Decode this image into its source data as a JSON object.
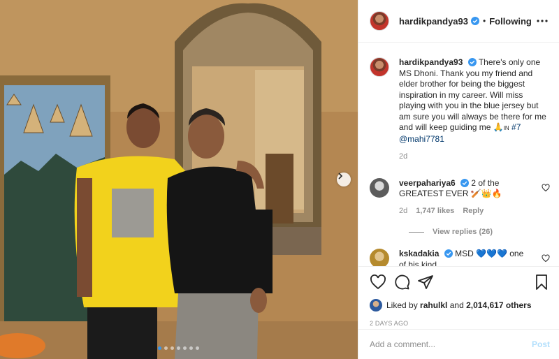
{
  "post": {
    "username": "hardikpandya93",
    "follow_status": "Following",
    "separator": "•",
    "caption": {
      "text": "There's only one MS Dhoni. Thank you my friend and elder brother for being the biggest inspiration in my career. Will miss playing with you in the blue jersey but am sure you will always be there for me and will keep guiding me 🙏",
      "in_label": "IN",
      "hashtag": "#7",
      "mention": "@mahi7781",
      "time": "2d"
    },
    "comments": [
      {
        "username": "veerpahariya6",
        "text": "2 of the GREATEST EVER 🏏👑🔥",
        "time": "2d",
        "likes": "1,747 likes",
        "reply_label": "Reply",
        "view_replies": "View replies (26)"
      },
      {
        "username": "kskadakia",
        "text": "MSD 💙💙💙 one of his kind"
      }
    ],
    "likes": {
      "liked_by_prefix": "Liked by",
      "liked_by_user": "rahulkl",
      "and": "and",
      "count": "2,014,617 others"
    },
    "timestamp": "2 DAYS AGO",
    "add_comment": {
      "placeholder": "Add a comment...",
      "post_label": "Post"
    },
    "carousel": {
      "count": 7,
      "active": 0
    },
    "colors": {
      "verified": "#3897f0",
      "link": "#00376b",
      "muted": "#8e8e8e",
      "post_disabled": "#b2dffc"
    },
    "icons": [
      "verified-icon",
      "more-icon",
      "heart-icon",
      "comment-icon",
      "share-icon",
      "bookmark-icon",
      "chevron-right-icon"
    ]
  }
}
